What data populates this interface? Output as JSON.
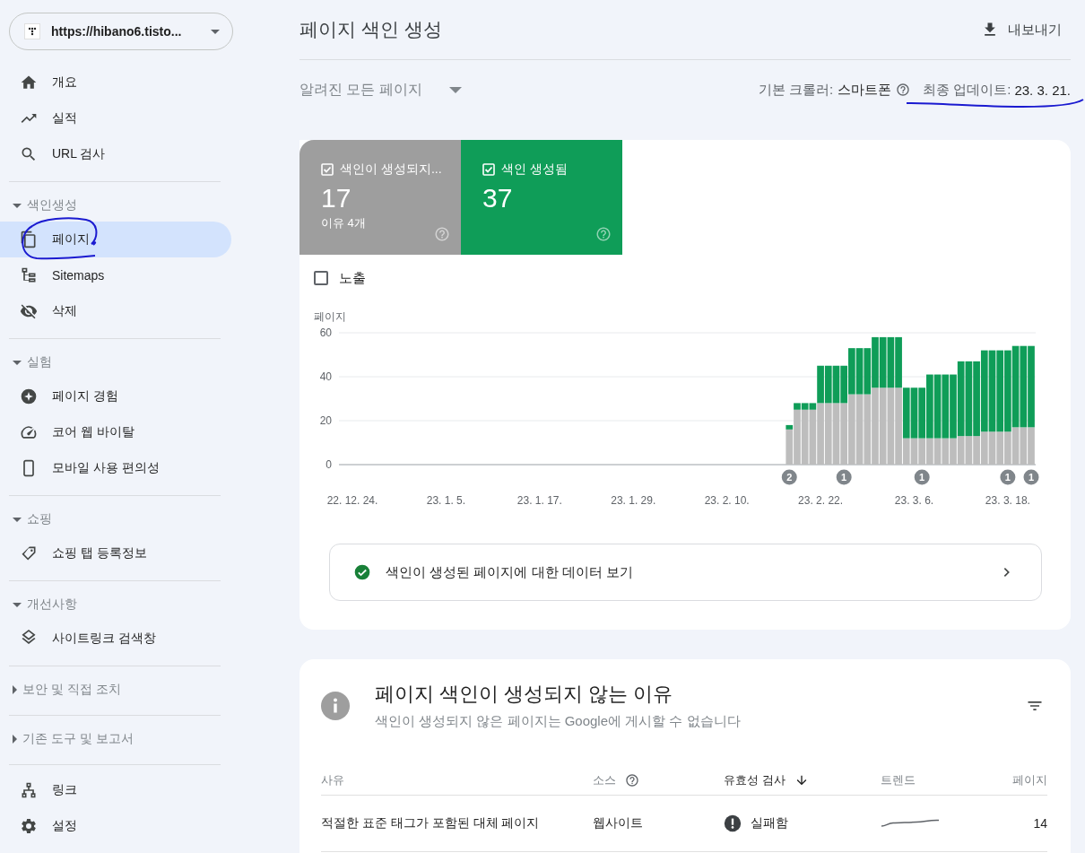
{
  "sidebar": {
    "property": {
      "url": "https://hibano6.tisto..."
    },
    "sections": [
      {
        "items": [
          {
            "label": "개요",
            "selected": false
          },
          {
            "label": "실적",
            "selected": false
          },
          {
            "label": "URL 검사",
            "selected": false
          }
        ]
      },
      {
        "heading": "색인생성",
        "expanded": true,
        "items": [
          {
            "label": "페이지",
            "selected": true
          },
          {
            "label": "Sitemaps",
            "selected": false
          },
          {
            "label": "삭제",
            "selected": false
          }
        ]
      },
      {
        "heading": "실험",
        "expanded": true,
        "items": [
          {
            "label": "페이지 경험",
            "selected": false
          },
          {
            "label": "코어 웹 바이탈",
            "selected": false
          },
          {
            "label": "모바일 사용 편의성",
            "selected": false
          }
        ]
      },
      {
        "heading": "쇼핑",
        "expanded": true,
        "items": [
          {
            "label": "쇼핑 탭 등록정보",
            "selected": false
          }
        ]
      },
      {
        "heading": "개선사항",
        "expanded": true,
        "items": [
          {
            "label": "사이트링크 검색창",
            "selected": false
          }
        ]
      },
      {
        "heading": "보안 및 직접 조치",
        "expanded": false
      },
      {
        "heading": "기존 도구 및 보고서",
        "expanded": false
      },
      {
        "items": [
          {
            "label": "링크",
            "selected": false
          },
          {
            "label": "설정",
            "selected": false
          }
        ]
      }
    ]
  },
  "header": {
    "title": "페이지 색인 생성",
    "export_label": "내보내기"
  },
  "filters": {
    "dropdown": "알려진 모든 페이지",
    "crawler_label": "기본 크롤러:",
    "crawler_value": "스마트폰",
    "update_label": "최종 업데이트:",
    "update_value": "23. 3. 21."
  },
  "summary": {
    "tiles": [
      {
        "label": "색인이 생성되지...",
        "count": "17",
        "note": "이유 4개",
        "checked": true,
        "color": "#9e9e9e"
      },
      {
        "label": "색인 생성됨",
        "count": "37",
        "checked": true,
        "color": "#0f9d58"
      }
    ],
    "impressions": {
      "label": "노출",
      "checked": false
    },
    "chart_data": {
      "type": "bar",
      "stacked": true,
      "ylabel": "페이지",
      "ylim": [
        0,
        60
      ],
      "yticks": [
        0,
        20,
        40,
        60
      ],
      "categories": [
        "22. 12. 24.",
        null,
        null,
        null,
        null,
        null,
        null,
        null,
        null,
        null,
        null,
        null,
        "23. 1. 5.",
        null,
        null,
        null,
        null,
        null,
        null,
        null,
        null,
        null,
        null,
        null,
        "23. 1. 17.",
        null,
        null,
        null,
        null,
        null,
        null,
        null,
        null,
        null,
        null,
        null,
        "23. 1. 29.",
        null,
        null,
        null,
        null,
        null,
        null,
        null,
        null,
        null,
        null,
        null,
        "23. 2. 10.",
        null,
        null,
        null,
        null,
        null,
        null,
        null,
        null,
        null,
        null,
        null,
        "23. 2. 22.",
        null,
        null,
        null,
        null,
        null,
        null,
        null,
        null,
        null,
        null,
        null,
        "23. 3. 6.",
        null,
        null,
        null,
        null,
        null,
        null,
        null,
        null,
        null,
        null,
        null,
        "23. 3. 18.",
        null,
        null,
        null
      ],
      "series": [
        {
          "color": "#bdbdbd",
          "values": [
            null,
            null,
            null,
            null,
            null,
            null,
            null,
            null,
            null,
            null,
            null,
            null,
            null,
            null,
            null,
            null,
            null,
            null,
            null,
            null,
            null,
            null,
            null,
            null,
            null,
            null,
            null,
            null,
            null,
            null,
            null,
            null,
            null,
            null,
            null,
            null,
            null,
            null,
            null,
            null,
            null,
            null,
            null,
            null,
            null,
            null,
            null,
            null,
            null,
            null,
            null,
            null,
            null,
            null,
            null,
            null,
            16,
            25,
            25,
            25,
            28,
            28,
            28,
            28,
            32,
            32,
            32,
            35,
            35,
            35,
            35,
            12,
            12,
            12,
            12,
            12,
            12,
            12,
            13,
            13,
            13,
            15,
            15,
            15,
            15,
            17,
            17,
            17
          ]
        },
        {
          "color": "#0f9d58",
          "values": [
            null,
            null,
            null,
            null,
            null,
            null,
            null,
            null,
            null,
            null,
            null,
            null,
            null,
            null,
            null,
            null,
            null,
            null,
            null,
            null,
            null,
            null,
            null,
            null,
            null,
            null,
            null,
            null,
            null,
            null,
            null,
            null,
            null,
            null,
            null,
            null,
            null,
            null,
            null,
            null,
            null,
            null,
            null,
            null,
            null,
            null,
            null,
            null,
            null,
            null,
            null,
            null,
            null,
            null,
            null,
            null,
            2,
            3,
            3,
            3,
            17,
            17,
            17,
            17,
            21,
            21,
            21,
            23,
            23,
            23,
            23,
            23,
            23,
            23,
            29,
            29,
            29,
            29,
            34,
            34,
            34,
            37,
            37,
            37,
            37,
            37,
            37,
            37
          ]
        }
      ],
      "annotations": [
        "2",
        "1",
        "1",
        "1",
        "1"
      ]
    },
    "link": "색인이 생성된 페이지에 대한 데이터 보기"
  },
  "reasons": {
    "title": "페이지 색인이 생성되지 않는 이유",
    "subtitle": "색인이 생성되지 않은 페이지는 Google에 게시할 수 없습니다",
    "columns": [
      {
        "label": "사유",
        "help": false,
        "sorted": false
      },
      {
        "label": "소스",
        "help": true,
        "sorted": false
      },
      {
        "label": "유효성 검사",
        "help": false,
        "sorted": true
      },
      {
        "label": "트렌드",
        "help": false,
        "sorted": false
      },
      {
        "label": "페이지",
        "help": false,
        "sorted": false
      }
    ],
    "rows": [
      {
        "reason": "적절한 표준 태그가 포함된 대체 페이지",
        "source": "웹사이트",
        "validation": {
          "kind": "failed",
          "label": "실패함"
        },
        "pages": "14"
      }
    ]
  }
}
